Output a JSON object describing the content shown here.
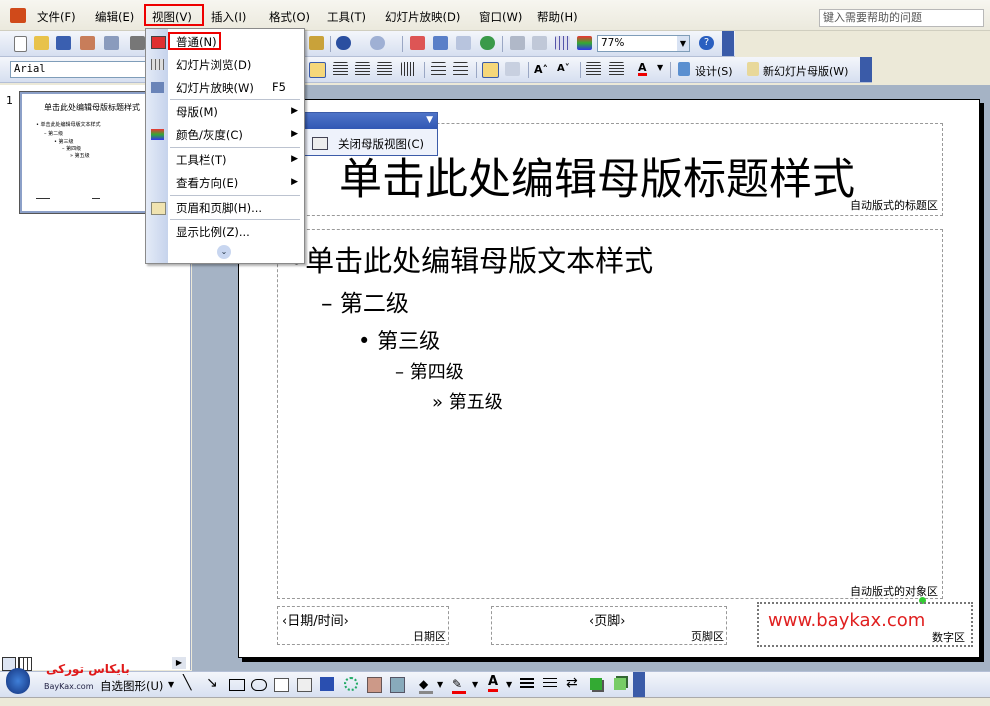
{
  "menubar": {
    "items": [
      "文件(F)",
      "编辑(E)",
      "视图(V)",
      "插入(I)",
      "格式(O)",
      "工具(T)",
      "幻灯片放映(D)",
      "窗口(W)",
      "帮助(H)"
    ],
    "help_placeholder": "键入需要帮助的问题"
  },
  "toolbar": {
    "zoom": "77%",
    "font": "Arial",
    "design_label": "设计(S)",
    "new_master_label": "新幻灯片母版(W)"
  },
  "view_menu": {
    "items": [
      {
        "label": "普通(N)",
        "shortcut": ""
      },
      {
        "label": "幻灯片浏览(D)",
        "shortcut": ""
      },
      {
        "label": "幻灯片放映(W)",
        "shortcut": "F5"
      },
      {
        "label": "母版(M)",
        "shortcut": ""
      },
      {
        "label": "颜色/灰度(C)",
        "shortcut": ""
      },
      {
        "label": "工具栏(T)",
        "shortcut": ""
      },
      {
        "label": "查看方向(E)",
        "shortcut": ""
      },
      {
        "label": "页眉和页脚(H)...",
        "shortcut": ""
      },
      {
        "label": "显示比例(Z)...",
        "shortcut": ""
      }
    ]
  },
  "floating_toolbar": {
    "close_master_label": "关闭母版视图(C)"
  },
  "thumbnail": {
    "number": "1",
    "title": "单击此处编辑母版标题样式",
    "body_lines": [
      "• 单击此处编辑母版文本样式",
      "– 第二级",
      "• 第三级",
      "– 第四级",
      "» 第五级"
    ]
  },
  "slide": {
    "title": "单击此处编辑母版标题样式",
    "title_area_label": "自动版式的标题区",
    "body_lines": [
      {
        "bullet": "•",
        "text": "单击此处编辑母版文本样式"
      },
      {
        "bullet": "–",
        "text": "第二级"
      },
      {
        "bullet": "•",
        "text": "第三级"
      },
      {
        "bullet": "–",
        "text": "第四级"
      },
      {
        "bullet": "»",
        "text": "第五级"
      }
    ],
    "object_area_label": "自动版式的对象区",
    "date_text": "‹日期/时间›",
    "date_area_label": "日期区",
    "footer_text": "‹页脚›",
    "footer_area_label": "页脚区",
    "number_area_label": "数字区",
    "watermark": "www.baykax.com"
  },
  "drawbar": {
    "autoshapes_label": "自选图形(U)",
    "logo_text": "بایکاس تورکی",
    "logo_sub": "BayKax.com"
  }
}
